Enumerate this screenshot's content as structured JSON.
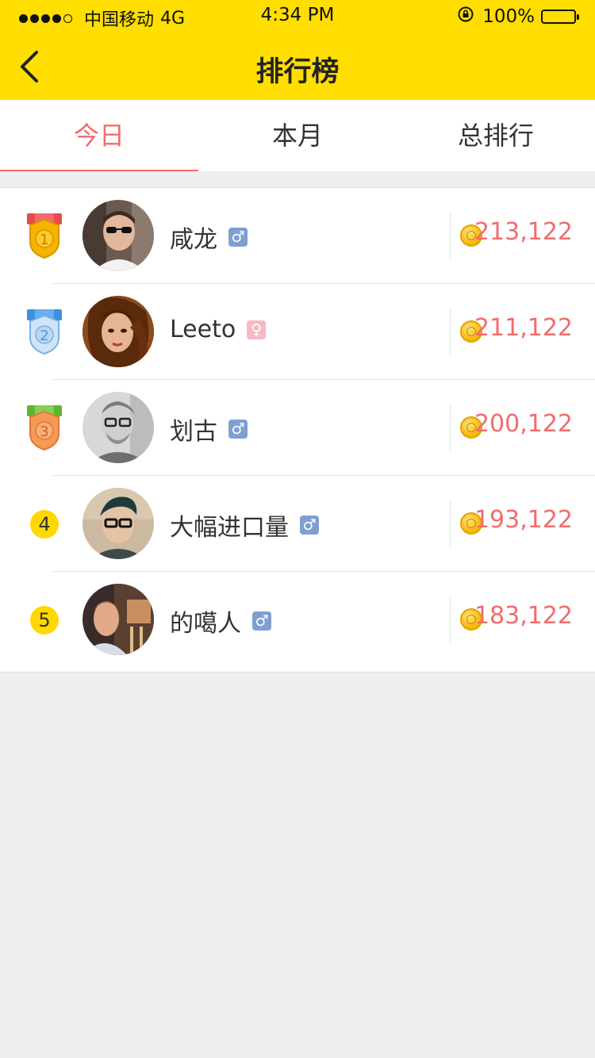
{
  "status_bar": {
    "carrier": "中国移动",
    "network": "4G",
    "time": "4:34 PM",
    "battery": "100%",
    "signal_icon": "signal-dots-icon",
    "rotation_lock_icon": "rotation-lock-icon",
    "battery_icon": "battery-icon"
  },
  "nav": {
    "title": "排行榜",
    "back_icon": "chevron-left-icon"
  },
  "tabs": [
    {
      "label": "今日",
      "active": true
    },
    {
      "label": "本月",
      "active": false
    },
    {
      "label": "总排行",
      "active": false
    }
  ],
  "colors": {
    "header_bg": "#ffde00",
    "accent_red": "#f26c6c",
    "male_badge": "#7f9fd0",
    "female_badge": "#f6b9c2",
    "rank_circle": "#ffd800"
  },
  "ranking": [
    {
      "rank": "1",
      "name": "咸龙",
      "gender": "male",
      "gender_symbol": "♂",
      "score": "213,122",
      "rank_icon": "gold-medal-icon"
    },
    {
      "rank": "2",
      "name": "Leeto",
      "gender": "female",
      "gender_symbol": "♀",
      "score": "211,122",
      "rank_icon": "silver-medal-icon"
    },
    {
      "rank": "3",
      "name": "划古",
      "gender": "male",
      "gender_symbol": "♂",
      "score": "200,122",
      "rank_icon": "bronze-medal-icon"
    },
    {
      "rank": "4",
      "name": "大幅进口量",
      "gender": "male",
      "gender_symbol": "♂",
      "score": "193,122",
      "rank_icon": "rank-circle-icon"
    },
    {
      "rank": "5",
      "name": "的噶人",
      "gender": "male",
      "gender_symbol": "♂",
      "score": "183,122",
      "rank_icon": "rank-circle-icon"
    }
  ]
}
